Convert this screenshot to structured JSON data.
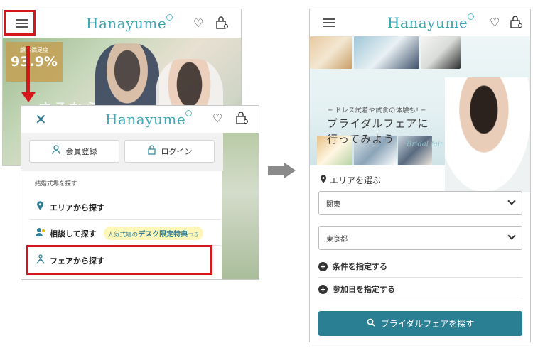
{
  "left_back_screen": {
    "logo": "Hanayume",
    "badge": {
      "line1": "顧客満足度",
      "line2": "93.9%"
    },
    "photo_overlay_text": "さるなら"
  },
  "drawer": {
    "logo": "Hanayume",
    "close_symbol": "✕",
    "register_button": "会員登録",
    "login_button": "ログイン",
    "section_label": "結婚式場を探す",
    "items": [
      {
        "label": "エリアから探す",
        "icon": "map-pin-icon"
      },
      {
        "label": "相談して探す",
        "icon": "consultant-icon",
        "pill": {
          "pre": "人気式場の",
          "highlight": "デスク限定特典",
          "post": "つき"
        }
      },
      {
        "label": "フェアから探す",
        "icon": "fair-icon"
      }
    ]
  },
  "right_screen": {
    "logo": "Hanayume",
    "banner": {
      "line1": "─ ドレス試着や試食の体験も! ─",
      "line2": "ブライダルフェアに",
      "line3": "行ってみよう",
      "script": "Bridal fair"
    },
    "area_title": "エリアを選ぶ",
    "region_select": "関東",
    "prefecture_select": "東京都",
    "conditions_label": "条件を指定する",
    "date_label": "参加日を指定する",
    "search_button": "ブライダルフェアを探す"
  },
  "colors": {
    "brand_teal": "#2b7f92",
    "highlight_red": "#d6161a",
    "pill_yellow": "#fff7b8"
  }
}
